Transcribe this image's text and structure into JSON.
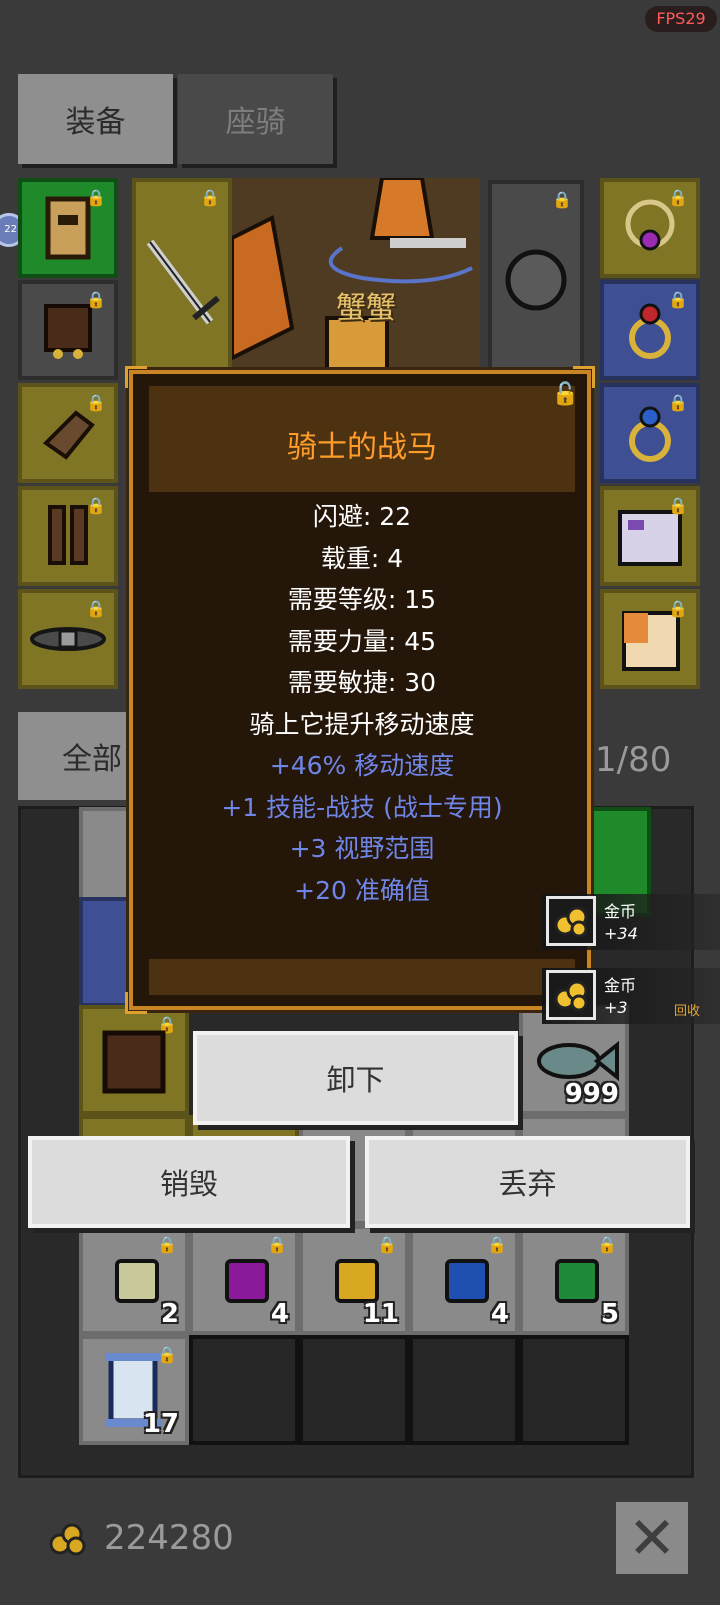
{
  "fps": "FPS29",
  "tabs": {
    "equip": "装备",
    "mount": "座骑"
  },
  "equipment": {
    "mount_name": "蟹蟹",
    "side_badge": "22"
  },
  "filter": {
    "all_label": "全部",
    "bag_count": "1/80"
  },
  "tooltip": {
    "title": "骑士的战马",
    "stats": [
      "闪避: 22",
      "载重: 4",
      "需要等级: 15",
      "需要力量: 45",
      "需要敏捷: 30",
      "骑上它提升移动速度"
    ],
    "bonuses": [
      "+46% 移动速度",
      "+1 技能-战技 (战士专用)",
      "+3 视野范围",
      "+20 准确值"
    ]
  },
  "toasts": [
    {
      "name": "金币",
      "amount": "+34",
      "recycle": ""
    },
    {
      "name": "金币",
      "amount": "+3",
      "recycle": "回收"
    }
  ],
  "inventory": {
    "fish_count": "999",
    "gem_counts": [
      "2",
      "4",
      "11",
      "4",
      "5"
    ],
    "scroll_count": "17"
  },
  "buttons": {
    "unequip": "卸下",
    "destroy": "销毁",
    "discard": "丢弃"
  },
  "gold": "224280",
  "colors": {
    "title": "#ff9c2a",
    "bonus": "#6f86e8",
    "frame": "#c98524"
  },
  "icons": [
    "lock-icon",
    "coin-icon",
    "close-icon",
    "sword-icon",
    "ring-icon",
    "gloves-icon",
    "boots-icon",
    "belt-icon",
    "armor-icon",
    "fish-icon",
    "gem-icon",
    "scroll-icon"
  ]
}
